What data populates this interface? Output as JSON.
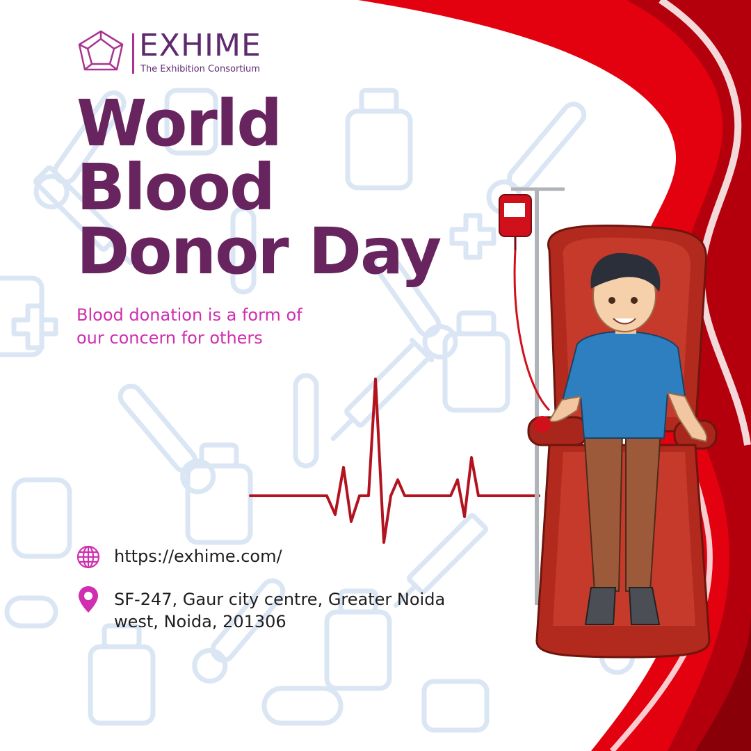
{
  "logo": {
    "name": "EXHIME",
    "subtitle": "The Exhibition Consortium"
  },
  "title": {
    "line1": "World",
    "line2": "Blood",
    "line3": "Donor Day"
  },
  "tagline": "Blood donation is a form of our concern for others",
  "contact": {
    "website": "https://exhime.com/",
    "address_line1": "SF-247, Gaur city centre, Greater Noida",
    "address_line2": "west, Noida, 201306"
  },
  "colors": {
    "brand_purple": "#68245e",
    "accent_magenta": "#cf2fb0",
    "ribbon_red": "#e3000f",
    "ribbon_dark_red": "#b4000c",
    "pattern_blue": "#d9e6f5"
  },
  "icons": {
    "website": "globe-icon",
    "address": "location-pin-icon",
    "logo": "polyhedron-logo-icon"
  }
}
